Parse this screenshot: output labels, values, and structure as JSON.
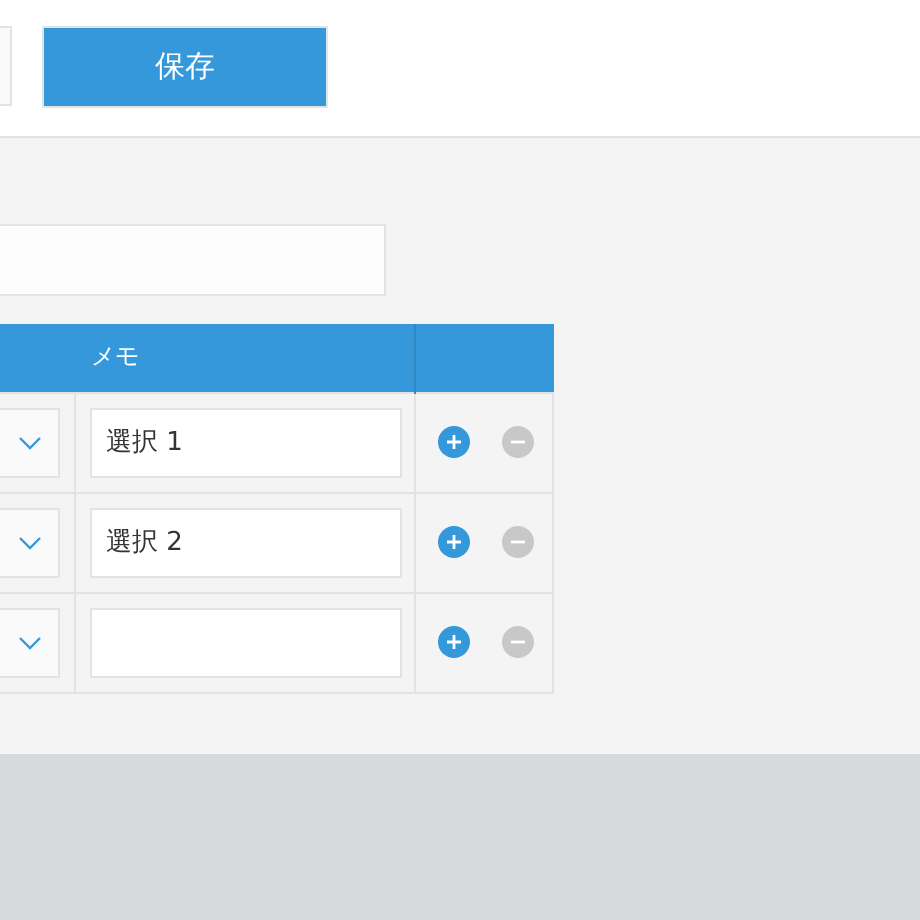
{
  "toolbar": {
    "save_button": "保存"
  },
  "table": {
    "columns": [
      "メモ"
    ],
    "rows": [
      {
        "memo": "選択 1"
      },
      {
        "memo": "選択 2"
      },
      {}
    ]
  }
}
